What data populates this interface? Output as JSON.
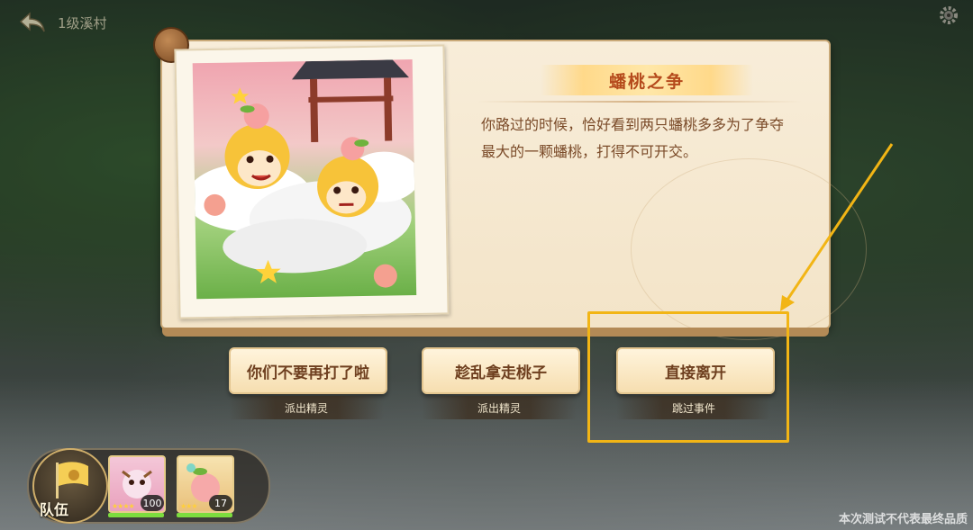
{
  "header": {
    "level_label": "1级溪村",
    "back_icon": "back-arrow-icon",
    "settings_icon": "gear-icon"
  },
  "event": {
    "title": "蟠桃之争",
    "description": "你路过的时候，恰好看到两只蟠桃多多为了争夺最大的一颗蟠桃，打得不可开交。"
  },
  "choices": [
    {
      "label": "你们不要再打了啦",
      "sub": "派出精灵"
    },
    {
      "label": "趁乱拿走桃子",
      "sub": "派出精灵"
    },
    {
      "label": "直接离开",
      "sub": "跳过事件"
    }
  ],
  "team": {
    "label": "队伍",
    "members": [
      {
        "level": "100",
        "hp_fraction": 1.0
      },
      {
        "level": "17",
        "hp_fraction": 1.0
      }
    ]
  },
  "watermark": "本次测试不代表最终品质",
  "colors": {
    "highlight": "#f2b515",
    "title": "#b54a1c",
    "text": "#7a4a28"
  }
}
